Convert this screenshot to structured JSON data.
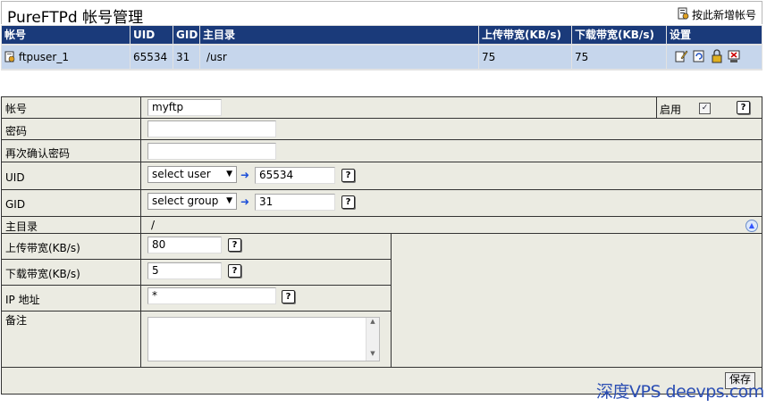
{
  "header": {
    "title": "PureFTPd 帐号管理",
    "add_user_label": "按此新增帐号"
  },
  "user_list": {
    "columns": [
      "帐号",
      "UID",
      "GID",
      "主目录",
      "上传带宽(KB/s)",
      "下载带宽(KB/s)",
      "设置"
    ],
    "rows": [
      {
        "account": "ftpuser_1",
        "uid": "65534",
        "gid": "31",
        "home": "/usr",
        "upload": "75",
        "download": "75"
      }
    ]
  },
  "form": {
    "account_label": "帐号",
    "account_value": "myftp",
    "enable_label": "启用",
    "enable_checked": true,
    "password_label": "密码",
    "password_value": "",
    "confirm_label": "再次确认密码",
    "confirm_value": "",
    "uid_label": "UID",
    "uid_select": "select user",
    "uid_value": "65534",
    "gid_label": "GID",
    "gid_select": "select group",
    "gid_value": "31",
    "home_label": "主目录",
    "home_value": "/",
    "upload_label": "上传带宽(KB/s)",
    "upload_value": "80",
    "download_label": "下载带宽(KB/s)",
    "download_value": "5",
    "ip_label": "IP 地址",
    "ip_value": "*",
    "note_label": "备注",
    "note_value": "",
    "save_label": "保存"
  },
  "help_glyph": "?",
  "watermark": "深度VPS deevps.com",
  "colors": {
    "header_bg": "#1a3a7a",
    "row_bg": "#c6d6ec",
    "form_bg": "#ebebe2",
    "watermark": "#2a4db3"
  }
}
